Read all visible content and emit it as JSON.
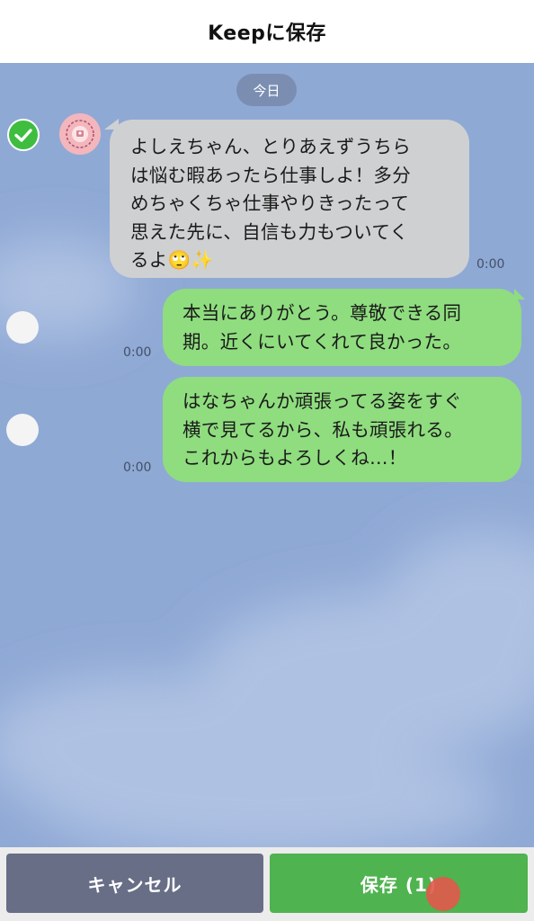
{
  "header": {
    "title": "Keepに保存"
  },
  "chat": {
    "date_label": "今日",
    "messages": [
      {
        "direction": "received",
        "selected": true,
        "lines": [
          "よしえちゃん、とりあえずうちら",
          "は悩む暇あったら仕事しよ！多分",
          "めちゃくちゃ仕事やりきったって",
          "思えた先に、自信も力もついてく",
          "るよ🙄✨"
        ],
        "time": "0:00"
      },
      {
        "direction": "sent",
        "selected": false,
        "lines": [
          "本当にありがとう。尊敬できる同",
          "期。近くにいてくれて良かった。"
        ],
        "time": "0:00"
      },
      {
        "direction": "sent",
        "selected": false,
        "lines": [
          "はなちゃんか頑張ってる姿をすぐ",
          "横で見てるから、私も頑張れる。",
          "これからもよろしくね…！"
        ],
        "time": "0:00"
      }
    ]
  },
  "footer": {
    "cancel_label": "キャンセル",
    "save_label": "保存 (1)"
  },
  "icons": {
    "check": "check-icon",
    "avatar": "user-avatar"
  },
  "colors": {
    "chat_background": "#8fa9d5",
    "received_bubble": "#cfd0d2",
    "sent_bubble": "#8fdd7f",
    "selected_check": "#3ebd3e",
    "cancel_button": "#676e86",
    "save_button": "#4fb34f"
  }
}
